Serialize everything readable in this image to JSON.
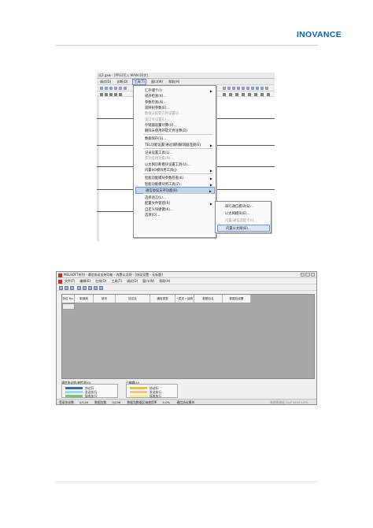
{
  "brand": "INOVANCE",
  "screenshot1": {
    "title": "试2.gxw - [PRG]写入 MAIN 83步]",
    "menubar": [
      "调试(D)",
      "诊断(D)",
      "工具(T)",
      "窗口(W)",
      "帮助(H)"
    ],
    "active_menu_index": 2,
    "tools_menu": [
      {
        "label": "汇存储卡(I)",
        "submenu": true,
        "disabled": false
      },
      {
        "label": "程序检查(K)...",
        "submenu": false,
        "disabled": false
      },
      {
        "label": "参数检查(A)...",
        "submenu": false,
        "disabled": false
      },
      {
        "label": "遥映射参数(E)...",
        "submenu": false,
        "disabled": false
      },
      {
        "label": "数值分配软元件设置(J)...",
        "submenu": false,
        "disabled": true
      },
      {
        "label": "读口令设置(L)...",
        "submenu": false,
        "disabled": true
      },
      {
        "label": "存储器容量计算(U)...",
        "submenu": false,
        "disabled": false
      },
      {
        "label": "删除未使用的软元件注释(D)",
        "submenu": false,
        "disabled": false
      },
      {
        "sep": true
      },
      {
        "label": "数据保存(S)...",
        "submenu": false,
        "disabled": false
      },
      {
        "label": "TEL功能设置/通过调制解调器连接(E)",
        "submenu": true,
        "disabled": false
      },
      {
        "sep": true
      },
      {
        "label": "记录设置工具(L)...",
        "submenu": false,
        "disabled": false
      },
      {
        "label": "系列监视功能(N)...",
        "submenu": false,
        "disabled": true
      },
      {
        "label": "以太网诊断模块设置工具(U)...",
        "submenu": false,
        "disabled": false
      },
      {
        "label": "内置I/O模块用工具(J)",
        "submenu": true,
        "disabled": false
      },
      {
        "sep": true
      },
      {
        "label": "智能功能模块参数检查(K)",
        "submenu": true,
        "disabled": false
      },
      {
        "label": "智能功能模块用工具(Z)",
        "submenu": true,
        "disabled": false
      },
      {
        "label": "通信协议支持功能(B)",
        "submenu": true,
        "disabled": false,
        "highlight": true
      },
      {
        "sep": true
      },
      {
        "label": "选择语言(L)...",
        "submenu": false,
        "disabled": false
      },
      {
        "label": "配置文件管理(R)",
        "submenu": true,
        "disabled": false
      },
      {
        "label": "自定义快捷键(K)...",
        "submenu": false,
        "disabled": false
      },
      {
        "label": "选项(O)...",
        "submenu": false,
        "disabled": false
      }
    ],
    "submenu": [
      {
        "label": "串行通信模块(S)...",
        "disabled": false
      },
      {
        "label": "以太网模块(E)...",
        "disabled": false
      },
      {
        "label": "内置/通信适配卡(I)...",
        "disabled": true
      },
      {
        "label": "内置以太网(B)...",
        "disabled": false,
        "highlight": true
      }
    ]
  },
  "screenshot2": {
    "title": "MELSOFT系列 - 通信协议支持功能 - 内置以太网 - [协议设置 - 无标题]",
    "menubar": [
      "文件(F)",
      "编辑(E)",
      "在线(O)",
      "工具(T)",
      "调试(D)",
      "窗口(W)",
      "帮助(H)"
    ],
    "columns": [
      "协议 No.",
      "制造商",
      "型号",
      "协议名",
      "通信类型",
      "→发送 ←接收",
      "数据包名",
      "数据包设置"
    ],
    "legend1": {
      "title": "通信协议库/被检测(Q)",
      "items": [
        {
          "label": "协议行",
          "color": "#2f6fb8"
        },
        {
          "label": "发送执行",
          "color": "#9fd4ee"
        },
        {
          "label": "接收执行",
          "color": "#79c86f"
        }
      ]
    },
    "legend2": {
      "title": "已编辑(U)",
      "items": [
        {
          "label": "协议行",
          "color": "#e6c640"
        },
        {
          "label": "发送执行",
          "color": "#f0c490"
        },
        {
          "label": "接收执行",
          "color": "#f6ef8a"
        }
      ]
    },
    "status": {
      "protocols_label": "登录协议数",
      "protocols_value": "0/128",
      "packets_label": "数据包数",
      "packets_value": "0/256",
      "area_label": "数据包数据区域使用率",
      "area_value": "0.0%",
      "mode": "通信协议模块",
      "right": "其他系统站 CAP NUM SCRL"
    }
  }
}
